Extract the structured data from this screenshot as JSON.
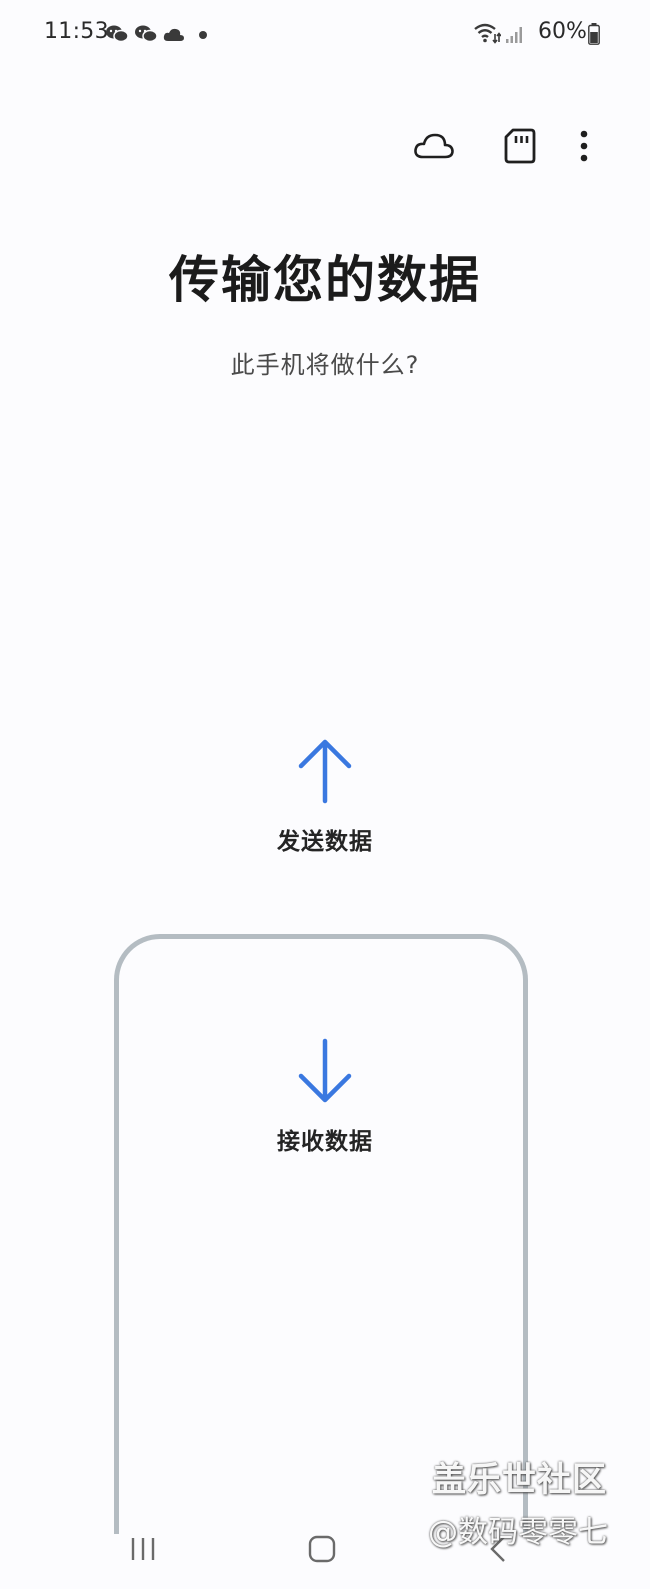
{
  "status_bar": {
    "time": "11:53",
    "battery": "60%",
    "icons": [
      "wechat-icon",
      "wechat-icon",
      "cloud-icon",
      "notification-dot",
      "wifi-icon",
      "signal-icon",
      "battery-icon"
    ]
  },
  "toolbar": {
    "icons": [
      "cloud-icon",
      "sd-card-icon",
      "more-options-icon"
    ]
  },
  "header": {
    "title": "传输您的数据",
    "subtitle": "此手机将做什么?"
  },
  "options": {
    "send_label": "发送数据",
    "receive_label": "接收数据"
  },
  "nav_bar": {
    "icons": [
      "recent-apps-icon",
      "home-icon",
      "back-icon"
    ]
  },
  "watermark": {
    "line1": "盖乐世社区",
    "line2": "@数码零零七"
  },
  "colors": {
    "accent": "#3a78e0",
    "frame": "#b4bcc2",
    "background": "#fcfcfe"
  }
}
